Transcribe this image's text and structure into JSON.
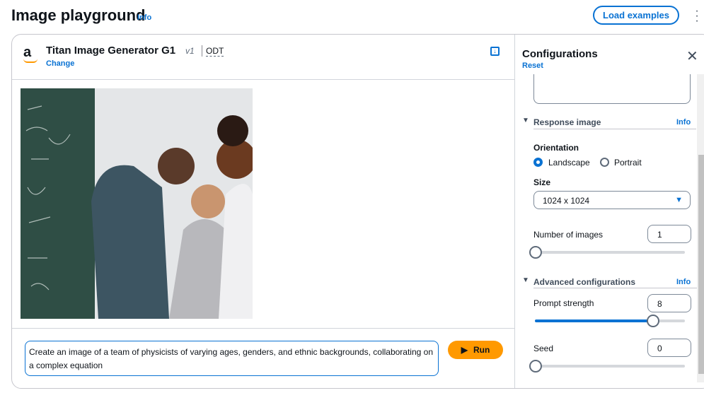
{
  "page": {
    "title": "Image playground",
    "info": "Info",
    "load_examples": "Load examples"
  },
  "model": {
    "name": "Titan Image Generator G1",
    "version": "v1",
    "tag": "ODT",
    "change": "Change"
  },
  "prompt": {
    "value": "Create an image of a team of physicists of varying ages, genders, and ethnic backgrounds, collaborating on a complex equation",
    "run": "Run"
  },
  "config": {
    "title": "Configurations",
    "reset": "Reset",
    "response_image": {
      "label": "Response image",
      "info": "Info",
      "orientation_label": "Orientation",
      "landscape": "Landscape",
      "portrait": "Portrait",
      "selected": "Landscape",
      "size_label": "Size",
      "size_value": "1024 x 1024",
      "num_images_label": "Number of images",
      "num_images": "1",
      "num_images_fraction": 0
    },
    "advanced": {
      "label": "Advanced configurations",
      "info": "Info",
      "prompt_strength_label": "Prompt strength",
      "prompt_strength": "8",
      "prompt_strength_fraction": 0.79,
      "seed_label": "Seed",
      "seed": "0",
      "seed_fraction": 0
    }
  },
  "colors": {
    "accent": "#0972d3",
    "run": "#ff9900"
  }
}
